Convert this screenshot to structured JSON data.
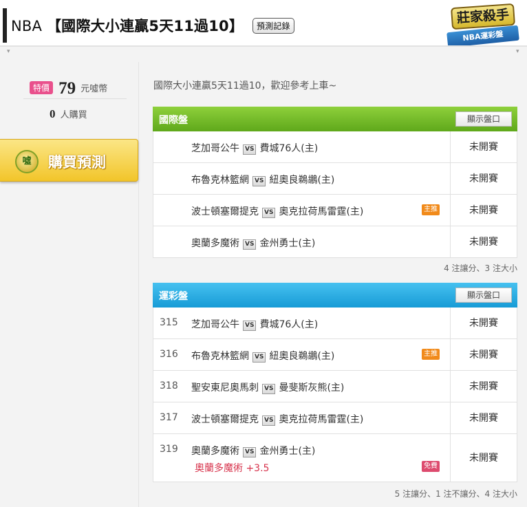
{
  "header": {
    "title_prefix": "NBA",
    "title_main": "【國際大小連贏5天11過10】",
    "record_button": "預測記錄",
    "logo_top": "莊家殺手",
    "logo_ribbon": "NBA運彩盤"
  },
  "sidebar": {
    "special_badge": "特價",
    "price": "79",
    "price_unit": "元噓幣",
    "buyers": "0",
    "buyers_text": "人購買",
    "buy_icon_text": "噓",
    "buy_button": "購買預測"
  },
  "intro": "國際大小連贏5天11過10，歡迎參考上車~",
  "international": {
    "title": "國際盤",
    "show_button": "顯示盤口",
    "rows": [
      {
        "away": "芝加哥公牛",
        "vs": "VS",
        "home": "費城76人(主)",
        "status": "未開賽"
      },
      {
        "away": "布魯克林籃網",
        "vs": "VS",
        "home": "紐奧良鵜鶘(主)",
        "status": "未開賽"
      },
      {
        "away": "波士頓塞爾提克",
        "vs": "VS",
        "home": "奧克拉荷馬雷霆(主)",
        "status": "未開賽",
        "tag": "主推"
      },
      {
        "away": "奧蘭多魔術",
        "vs": "VS",
        "home": "金州勇士(主)",
        "status": "未開賽"
      }
    ],
    "footnote": "4 注讓分、3 注大小"
  },
  "sportslottery": {
    "title": "運彩盤",
    "show_button": "顯示盤口",
    "rows": [
      {
        "num": "315",
        "away": "芝加哥公牛",
        "vs": "VS",
        "home": "費城76人(主)",
        "status": "未開賽"
      },
      {
        "num": "316",
        "away": "布魯克林籃網",
        "vs": "VS",
        "home": "紐奧良鵜鶘(主)",
        "status": "未開賽",
        "tag": "主推"
      },
      {
        "num": "318",
        "away": "聖安東尼奧馬刺",
        "vs": "VS",
        "home": "曼斐斯灰熊(主)",
        "status": "未開賽"
      },
      {
        "num": "317",
        "away": "波士頓塞爾提克",
        "vs": "VS",
        "home": "奧克拉荷馬雷霆(主)",
        "status": "未開賽"
      },
      {
        "num": "319",
        "away": "奧蘭多魔術",
        "vs": "VS",
        "home": "金州勇士(主)",
        "status": "未開賽",
        "pick": "奧蘭多魔術 +3.5",
        "tag": "免費"
      }
    ],
    "footnote": "5 注讓分、1 注不讓分、4 注大小"
  }
}
